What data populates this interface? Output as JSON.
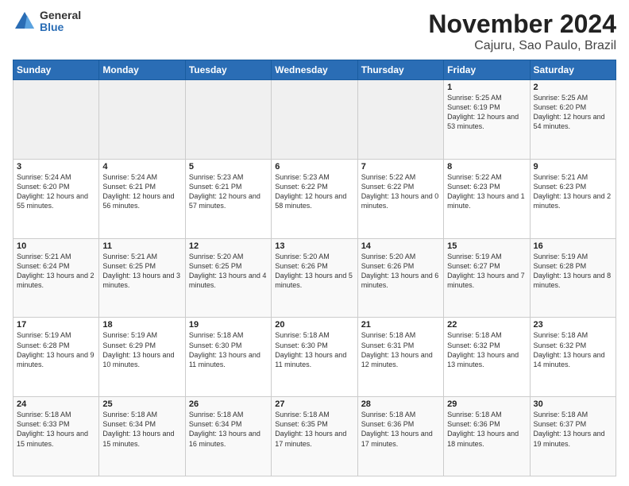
{
  "logo": {
    "general": "General",
    "blue": "Blue"
  },
  "title": {
    "month": "November 2024",
    "location": "Cajuru, Sao Paulo, Brazil"
  },
  "days_of_week": [
    "Sunday",
    "Monday",
    "Tuesday",
    "Wednesday",
    "Thursday",
    "Friday",
    "Saturday"
  ],
  "weeks": [
    [
      {
        "num": "",
        "info": ""
      },
      {
        "num": "",
        "info": ""
      },
      {
        "num": "",
        "info": ""
      },
      {
        "num": "",
        "info": ""
      },
      {
        "num": "",
        "info": ""
      },
      {
        "num": "1",
        "info": "Sunrise: 5:25 AM\nSunset: 6:19 PM\nDaylight: 12 hours and 53 minutes."
      },
      {
        "num": "2",
        "info": "Sunrise: 5:25 AM\nSunset: 6:20 PM\nDaylight: 12 hours and 54 minutes."
      }
    ],
    [
      {
        "num": "3",
        "info": "Sunrise: 5:24 AM\nSunset: 6:20 PM\nDaylight: 12 hours and 55 minutes."
      },
      {
        "num": "4",
        "info": "Sunrise: 5:24 AM\nSunset: 6:21 PM\nDaylight: 12 hours and 56 minutes."
      },
      {
        "num": "5",
        "info": "Sunrise: 5:23 AM\nSunset: 6:21 PM\nDaylight: 12 hours and 57 minutes."
      },
      {
        "num": "6",
        "info": "Sunrise: 5:23 AM\nSunset: 6:22 PM\nDaylight: 12 hours and 58 minutes."
      },
      {
        "num": "7",
        "info": "Sunrise: 5:22 AM\nSunset: 6:22 PM\nDaylight: 13 hours and 0 minutes."
      },
      {
        "num": "8",
        "info": "Sunrise: 5:22 AM\nSunset: 6:23 PM\nDaylight: 13 hours and 1 minute."
      },
      {
        "num": "9",
        "info": "Sunrise: 5:21 AM\nSunset: 6:23 PM\nDaylight: 13 hours and 2 minutes."
      }
    ],
    [
      {
        "num": "10",
        "info": "Sunrise: 5:21 AM\nSunset: 6:24 PM\nDaylight: 13 hours and 2 minutes."
      },
      {
        "num": "11",
        "info": "Sunrise: 5:21 AM\nSunset: 6:25 PM\nDaylight: 13 hours and 3 minutes."
      },
      {
        "num": "12",
        "info": "Sunrise: 5:20 AM\nSunset: 6:25 PM\nDaylight: 13 hours and 4 minutes."
      },
      {
        "num": "13",
        "info": "Sunrise: 5:20 AM\nSunset: 6:26 PM\nDaylight: 13 hours and 5 minutes."
      },
      {
        "num": "14",
        "info": "Sunrise: 5:20 AM\nSunset: 6:26 PM\nDaylight: 13 hours and 6 minutes."
      },
      {
        "num": "15",
        "info": "Sunrise: 5:19 AM\nSunset: 6:27 PM\nDaylight: 13 hours and 7 minutes."
      },
      {
        "num": "16",
        "info": "Sunrise: 5:19 AM\nSunset: 6:28 PM\nDaylight: 13 hours and 8 minutes."
      }
    ],
    [
      {
        "num": "17",
        "info": "Sunrise: 5:19 AM\nSunset: 6:28 PM\nDaylight: 13 hours and 9 minutes."
      },
      {
        "num": "18",
        "info": "Sunrise: 5:19 AM\nSunset: 6:29 PM\nDaylight: 13 hours and 10 minutes."
      },
      {
        "num": "19",
        "info": "Sunrise: 5:18 AM\nSunset: 6:30 PM\nDaylight: 13 hours and 11 minutes."
      },
      {
        "num": "20",
        "info": "Sunrise: 5:18 AM\nSunset: 6:30 PM\nDaylight: 13 hours and 11 minutes."
      },
      {
        "num": "21",
        "info": "Sunrise: 5:18 AM\nSunset: 6:31 PM\nDaylight: 13 hours and 12 minutes."
      },
      {
        "num": "22",
        "info": "Sunrise: 5:18 AM\nSunset: 6:32 PM\nDaylight: 13 hours and 13 minutes."
      },
      {
        "num": "23",
        "info": "Sunrise: 5:18 AM\nSunset: 6:32 PM\nDaylight: 13 hours and 14 minutes."
      }
    ],
    [
      {
        "num": "24",
        "info": "Sunrise: 5:18 AM\nSunset: 6:33 PM\nDaylight: 13 hours and 15 minutes."
      },
      {
        "num": "25",
        "info": "Sunrise: 5:18 AM\nSunset: 6:34 PM\nDaylight: 13 hours and 15 minutes."
      },
      {
        "num": "26",
        "info": "Sunrise: 5:18 AM\nSunset: 6:34 PM\nDaylight: 13 hours and 16 minutes."
      },
      {
        "num": "27",
        "info": "Sunrise: 5:18 AM\nSunset: 6:35 PM\nDaylight: 13 hours and 17 minutes."
      },
      {
        "num": "28",
        "info": "Sunrise: 5:18 AM\nSunset: 6:36 PM\nDaylight: 13 hours and 17 minutes."
      },
      {
        "num": "29",
        "info": "Sunrise: 5:18 AM\nSunset: 6:36 PM\nDaylight: 13 hours and 18 minutes."
      },
      {
        "num": "30",
        "info": "Sunrise: 5:18 AM\nSunset: 6:37 PM\nDaylight: 13 hours and 19 minutes."
      }
    ]
  ]
}
